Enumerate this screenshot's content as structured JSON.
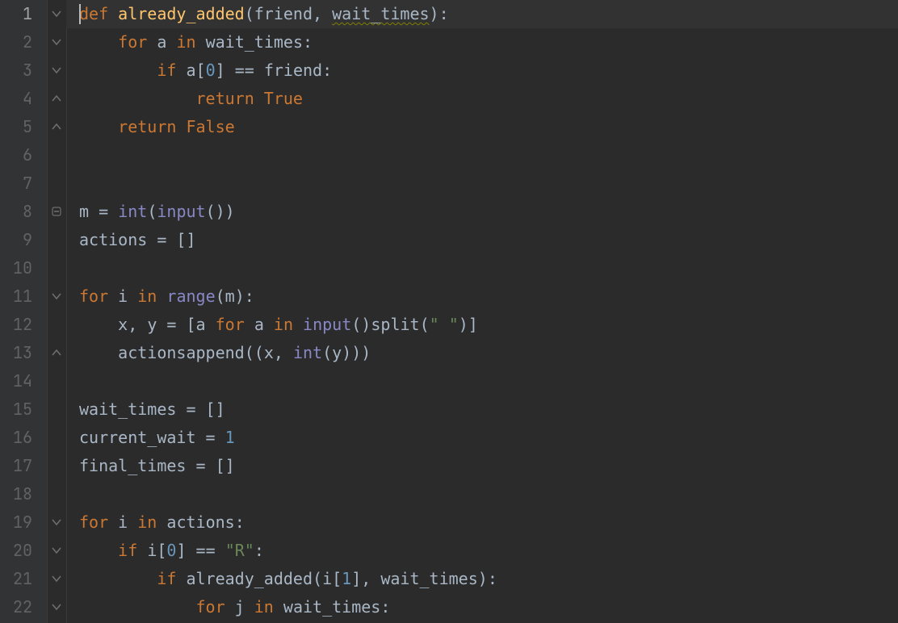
{
  "editor": {
    "current_line_index": 0,
    "line_numbers": [
      "1",
      "2",
      "3",
      "4",
      "5",
      "6",
      "7",
      "8",
      "9",
      "10",
      "11",
      "12",
      "13",
      "14",
      "15",
      "16",
      "17",
      "18",
      "19",
      "20",
      "21",
      "22"
    ],
    "fold_marks": [
      {
        "line": 1,
        "type": "open"
      },
      {
        "line": 2,
        "type": "open"
      },
      {
        "line": 3,
        "type": "open"
      },
      {
        "line": 4,
        "type": "close"
      },
      {
        "line": 5,
        "type": "close"
      },
      {
        "line": 8,
        "type": "open-single"
      },
      {
        "line": 11,
        "type": "open"
      },
      {
        "line": 13,
        "type": "close"
      },
      {
        "line": 19,
        "type": "open"
      },
      {
        "line": 20,
        "type": "open"
      },
      {
        "line": 21,
        "type": "open"
      },
      {
        "line": 22,
        "type": "open"
      }
    ]
  },
  "code": {
    "l1": {
      "kw_def": "def",
      "fn": "already_added",
      "paren_open": "(",
      "p1": "friend",
      "comma": ", ",
      "p2": "wait_times",
      "paren_close_colon": "):"
    },
    "l2": {
      "indent": "    ",
      "kw_for": "for",
      "sp": " ",
      "var": "a",
      "sp2": " ",
      "kw_in": "in",
      "sp3": " ",
      "iter": "wait_times",
      "colon": ":"
    },
    "l3": {
      "indent": "        ",
      "kw_if": "if",
      "sp": " ",
      "var": "a",
      "br_o": "[",
      "idx": "0",
      "br_c": "]",
      "sp2": " ",
      "op": "==",
      "sp3": " ",
      "rhs": "friend",
      "colon": ":"
    },
    "l4": {
      "indent": "            ",
      "kw_return": "return",
      "sp": " ",
      "val": "True"
    },
    "l5": {
      "indent": "    ",
      "kw_return": "return",
      "sp": " ",
      "val": "False"
    },
    "l6": "",
    "l7": "",
    "l8": {
      "lhs": "m ",
      "op": "=",
      "sp": " ",
      "bi_int": "int",
      "po": "(",
      "bi_input": "input",
      "pi": "()",
      ")": " )",
      "pc": ")"
    },
    "l9": {
      "lhs": "actions ",
      "op": "=",
      "sp": " ",
      "val": "[]"
    },
    "l10": "",
    "l11": {
      "kw_for": "for",
      "sp": " ",
      "var": "i",
      "sp2": " ",
      "kw_in": "in",
      "sp3": " ",
      "bi_range": "range",
      "po": "(",
      "arg": "m",
      "pc": ")",
      "colon": ":"
    },
    "l12": {
      "indent": "    ",
      "lhs": "x",
      "comma": ",",
      "sp": " ",
      "lhs2": "y ",
      "op": "=",
      "sp2": " ",
      "br_o": "[",
      "var": "a ",
      "kw_for": "for",
      "sp3": " ",
      "var2": "a ",
      "kw_in": "in",
      "sp4": " ",
      "bi_input": "input",
      "pi": "()",
      ".": ".",
      "meth": "split",
      "po": "(",
      "str": "\" \"",
      "pc": ")",
      "br_c": "]"
    },
    "l13": {
      "indent": "    ",
      "obj": "actions",
      ".": ".",
      "meth": "append",
      "po": "(",
      "po2": "(",
      "a1": "x",
      "comma": ", ",
      "bi_int": "int",
      "po3": "(",
      "a2": "y",
      "pc3": ")",
      "pc2": ")",
      "pc": ")"
    },
    "l14": "",
    "l15": {
      "lhs": "wait_times ",
      "op": "=",
      "sp": " ",
      "val": "[]"
    },
    "l16": {
      "lhs": "current_wait ",
      "op": "=",
      "sp": " ",
      "val": "1"
    },
    "l17": {
      "lhs": "final_times ",
      "op": "=",
      "sp": " ",
      "val": "[]"
    },
    "l18": "",
    "l19": {
      "kw_for": "for",
      "sp": " ",
      "var": "i",
      "sp2": " ",
      "kw_in": "in",
      "sp3": " ",
      "iter": "actions",
      "colon": ":"
    },
    "l20": {
      "indent": "    ",
      "kw_if": "if",
      "sp": " ",
      "var": "i",
      "br_o": "[",
      "idx": "0",
      "br_c": "]",
      "sp2": " ",
      "op": "==",
      "sp3": " ",
      "str": "\"R\"",
      "colon": ":"
    },
    "l21": {
      "indent": "        ",
      "kw_if": "if",
      "sp": " ",
      "fn": "already_added",
      "po": "(",
      "a1": "i",
      "br_o": "[",
      "idx": "1",
      "br_c": "]",
      "comma": ", ",
      "a2": "wait_times",
      "pc": ")",
      "colon": ":"
    },
    "l22": {
      "indent": "            ",
      "kw_for": "for",
      "sp": " ",
      "var": "j",
      "sp2": " ",
      "kw_in": "in",
      "sp3": " ",
      "iter": "wait_times",
      "colon": ":"
    }
  }
}
